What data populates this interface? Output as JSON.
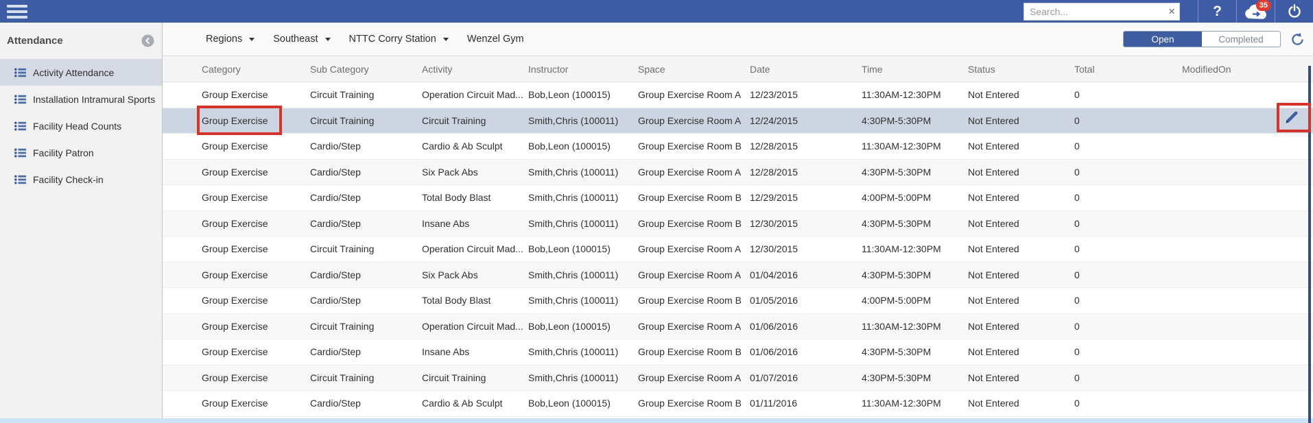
{
  "topbar": {
    "search_placeholder": "Search...",
    "badge_count": "35",
    "icons": {
      "help": "?",
      "clear_search": "×"
    }
  },
  "sidebar": {
    "title": "Attendance",
    "items": [
      {
        "label": "Activity Attendance",
        "selected": true
      },
      {
        "label": "Installation Intramural Sports",
        "selected": false
      },
      {
        "label": "Facility Head Counts",
        "selected": false
      },
      {
        "label": "Facility Patron",
        "selected": false
      },
      {
        "label": "Facility Check-in",
        "selected": false
      }
    ]
  },
  "toolbar": {
    "breadcrumbs": [
      {
        "label": "Regions",
        "dropdown": true
      },
      {
        "label": "Southeast",
        "dropdown": true
      },
      {
        "label": "NTTC Corry Station",
        "dropdown": true
      },
      {
        "label": "Wenzel Gym",
        "dropdown": false
      }
    ],
    "open_label": "Open",
    "completed_label": "Completed"
  },
  "table": {
    "columns": [
      "Category",
      "Sub Category",
      "Activity",
      "Instructor",
      "Space",
      "Date",
      "Time",
      "Status",
      "Total",
      "ModifiedOn"
    ],
    "highlighted_row_index": 1,
    "rows": [
      [
        "Group Exercise",
        "Circuit Training",
        "Operation Circuit Mad...",
        "Bob,Leon (100015)",
        "Group Exercise Room A",
        "12/23/2015",
        "11:30AM-12:30PM",
        "Not Entered",
        "0",
        ""
      ],
      [
        "Group Exercise",
        "Circuit Training",
        "Circuit Training",
        "Smith,Chris (100011)",
        "Group Exercise Room A",
        "12/24/2015",
        "4:30PM-5:30PM",
        "Not Entered",
        "0",
        ""
      ],
      [
        "Group Exercise",
        "Cardio/Step",
        "Cardio & Ab Sculpt",
        "Bob,Leon (100015)",
        "Group Exercise Room B",
        "12/28/2015",
        "11:30AM-12:30PM",
        "Not Entered",
        "0",
        ""
      ],
      [
        "Group Exercise",
        "Cardio/Step",
        "Six Pack Abs",
        "Smith,Chris (100011)",
        "Group Exercise Room A",
        "12/28/2015",
        "4:30PM-5:30PM",
        "Not Entered",
        "0",
        ""
      ],
      [
        "Group Exercise",
        "Cardio/Step",
        "Total Body Blast",
        "Smith,Chris (100011)",
        "Group Exercise Room B",
        "12/29/2015",
        "4:00PM-5:00PM",
        "Not Entered",
        "0",
        ""
      ],
      [
        "Group Exercise",
        "Cardio/Step",
        "Insane Abs",
        "Smith,Chris (100011)",
        "Group Exercise Room B",
        "12/30/2015",
        "4:30PM-5:30PM",
        "Not Entered",
        "0",
        ""
      ],
      [
        "Group Exercise",
        "Circuit Training",
        "Operation Circuit Mad...",
        "Bob,Leon (100015)",
        "Group Exercise Room A",
        "12/30/2015",
        "11:30AM-12:30PM",
        "Not Entered",
        "0",
        ""
      ],
      [
        "Group Exercise",
        "Cardio/Step",
        "Six Pack Abs",
        "Smith,Chris (100011)",
        "Group Exercise Room A",
        "01/04/2016",
        "4:30PM-5:30PM",
        "Not Entered",
        "0",
        ""
      ],
      [
        "Group Exercise",
        "Cardio/Step",
        "Total Body Blast",
        "Smith,Chris (100011)",
        "Group Exercise Room B",
        "01/05/2016",
        "4:00PM-5:00PM",
        "Not Entered",
        "0",
        ""
      ],
      [
        "Group Exercise",
        "Circuit Training",
        "Operation Circuit Mad...",
        "Bob,Leon (100015)",
        "Group Exercise Room A",
        "01/06/2016",
        "11:30AM-12:30PM",
        "Not Entered",
        "0",
        ""
      ],
      [
        "Group Exercise",
        "Cardio/Step",
        "Insane Abs",
        "Smith,Chris (100011)",
        "Group Exercise Room B",
        "01/06/2016",
        "4:30PM-5:30PM",
        "Not Entered",
        "0",
        ""
      ],
      [
        "Group Exercise",
        "Circuit Training",
        "Circuit Training",
        "Smith,Chris (100011)",
        "Group Exercise Room A",
        "01/07/2016",
        "4:30PM-5:30PM",
        "Not Entered",
        "0",
        ""
      ],
      [
        "Group Exercise",
        "Cardio/Step",
        "Cardio & Ab Sculpt",
        "Bob,Leon (100015)",
        "Group Exercise Room B",
        "01/11/2016",
        "11:30AM-12:30PM",
        "Not Entered",
        "0",
        ""
      ]
    ]
  },
  "colors": {
    "topbar_blue": "#3e5ba5",
    "open_button_blue": "#3e5ca0",
    "selected_row": "#ced5e2",
    "sidebar_selected": "#d5dae4",
    "annotation_red": "#d4342c",
    "badge_red": "#e23b30",
    "scrollbar_strip_blue": "#cde2f5"
  }
}
